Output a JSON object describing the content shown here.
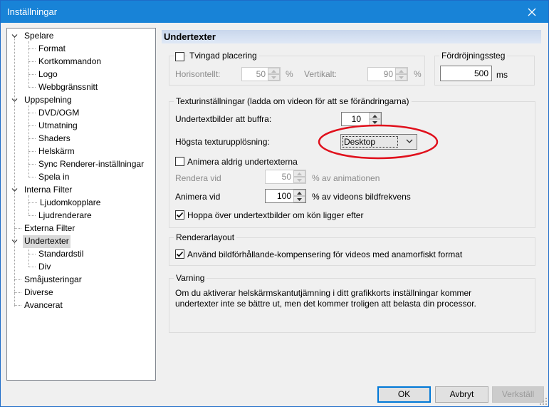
{
  "window": {
    "title": "Inställningar"
  },
  "tree": {
    "items": [
      {
        "label": "Spelare"
      },
      {
        "label": "Format"
      },
      {
        "label": "Kortkommandon"
      },
      {
        "label": "Logo"
      },
      {
        "label": "Webbgränssnitt"
      },
      {
        "label": "Uppspelning"
      },
      {
        "label": "DVD/OGM"
      },
      {
        "label": "Utmatning"
      },
      {
        "label": "Shaders"
      },
      {
        "label": "Helskärm"
      },
      {
        "label": "Sync Renderer-inställningar"
      },
      {
        "label": "Spela in"
      },
      {
        "label": "Interna Filter"
      },
      {
        "label": "Ljudomkopplare"
      },
      {
        "label": "Ljudrenderare"
      },
      {
        "label": "Externa Filter"
      },
      {
        "label": "Undertexter"
      },
      {
        "label": "Standardstil"
      },
      {
        "label": "Div"
      },
      {
        "label": "Småjusteringar"
      },
      {
        "label": "Diverse"
      },
      {
        "label": "Avancerat"
      }
    ],
    "selected": "Undertexter"
  },
  "page": {
    "title": "Undertexter",
    "placement": {
      "forced_label": "Tvingad placering",
      "forced_checked": false,
      "horizontal_label": "Horisontellt:",
      "horizontal_value": "50",
      "horizontal_unit": "%",
      "vertical_label": "Vertikalt:",
      "vertical_value": "90",
      "vertical_unit": "%"
    },
    "delay": {
      "group_title": "Fördröjningssteg",
      "value": "500",
      "unit": "ms"
    },
    "texture": {
      "group_title": "Texturinställningar (ladda om videon för att se förändringarna)",
      "buffer_label": "Undertextbilder att buffra:",
      "buffer_value": "10",
      "max_res_label": "Högsta texturupplösning:",
      "max_res_value": "Desktop",
      "never_animate_label": "Animera aldrig undertexterna",
      "never_animate_checked": false,
      "render_at_label": "Rendera vid",
      "render_at_value": "50",
      "render_at_suffix": "% av animationen",
      "animate_at_label": "Animera vid",
      "animate_at_value": "100",
      "animate_at_suffix": "% av videons bildfrekvens",
      "skip_label": "Hoppa över undertextbilder om kön ligger efter",
      "skip_checked": true
    },
    "layout": {
      "group_title": "Renderarlayout",
      "anamorphic_label": "Använd bildförhållande-kompensering för videos med anamorfiskt format",
      "anamorphic_checked": true
    },
    "warning": {
      "group_title": "Varning",
      "text": "Om du aktiverar helskärmskantutjämning i ditt grafikkorts inställningar kommer undertexter inte se bättre ut, men det kommer troligen att belasta din processor."
    }
  },
  "buttons": {
    "ok": "OK",
    "cancel": "Avbryt",
    "apply": "Verkställ"
  },
  "colors": {
    "titlebar": "#1883d7",
    "highlight_ellipse": "#e0101c",
    "header_gradient": "#c9d7ec"
  }
}
